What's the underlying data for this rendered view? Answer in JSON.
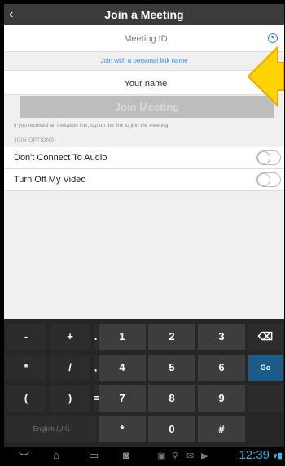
{
  "header": {
    "title": "Join a Meeting",
    "back_icon": "‹"
  },
  "meeting_id": {
    "placeholder": "Meeting ID"
  },
  "personal_link": {
    "label": "Join with a personal link name"
  },
  "name_field": {
    "value": "Your name"
  },
  "join_button": {
    "label": "Join Meeting"
  },
  "hint": "If you received an invitation link, tap on the link to join the meeting.",
  "section_title": "JOIN OPTIONS",
  "options": [
    {
      "label": "Don't Connect To Audio",
      "enabled": false
    },
    {
      "label": "Turn Off My Video",
      "enabled": false
    }
  ],
  "keyboard": {
    "rows": [
      [
        "-",
        "+",
        ".",
        "1",
        "2",
        "3",
        "⌫"
      ],
      [
        "*",
        "/",
        ",",
        "4",
        "5",
        "6",
        "Go"
      ],
      [
        "(",
        ")",
        "=",
        "7",
        "8",
        "9",
        ""
      ],
      [
        "English (UK)",
        "*",
        "0",
        "#"
      ]
    ]
  },
  "status_bar": {
    "time": "12:39"
  },
  "colors": {
    "accent": "#2d8cff",
    "arrow": "#ffd400",
    "time": "#33b5e5"
  }
}
